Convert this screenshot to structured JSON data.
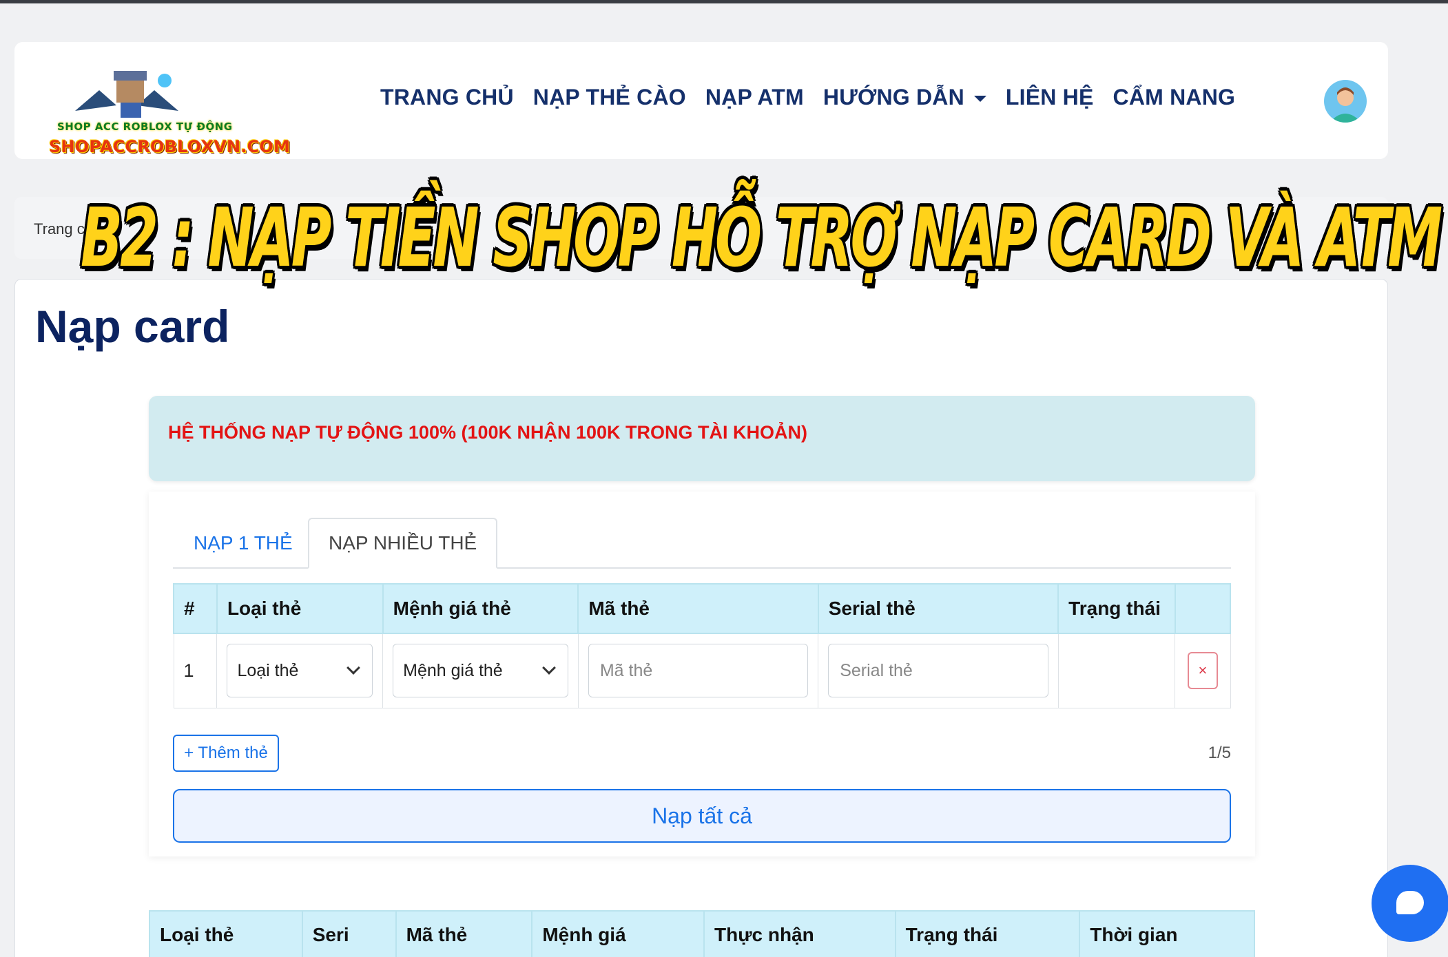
{
  "logo": {
    "line1": "SHOP ACC ROBLOX TỰ ĐỘNG",
    "line2": "SHOPACCROBLOXVN.COM"
  },
  "nav": {
    "items": [
      "TRANG CHỦ",
      "NẠP THẺ CÀO",
      "NẠP ATM",
      "HƯỚNG DẪN",
      "LIÊN HỆ",
      "CẨM NANG"
    ]
  },
  "breadcrumb": {
    "text": "Trang c"
  },
  "banner": {
    "text": "B2 : NẠP TIỀN SHOP HỖ TRỢ NẠP CARD VÀ ATM"
  },
  "page": {
    "title": "Nạp card"
  },
  "alert": {
    "text": "HỆ THỐNG NẠP TỰ ĐỘNG 100% (100K NHẬN 100K TRONG TÀI KHOẢN)"
  },
  "tabs": {
    "single": "NẠP 1 THẺ",
    "multi": "NẠP NHIỀU THẺ"
  },
  "form_table": {
    "headers": [
      "#",
      "Loại thẻ",
      "Mệnh giá thẻ",
      "Mã thẻ",
      "Serial thẻ",
      "Trạng thái",
      ""
    ],
    "row": {
      "index": "1",
      "card_type": "Loại thẻ",
      "denomination": "Mệnh giá thẻ",
      "code_placeholder": "Mã thẻ",
      "serial_placeholder": "Serial thẻ",
      "status": "",
      "delete": "×"
    }
  },
  "actions": {
    "add_card": "+ Thêm thẻ",
    "count": "1/5",
    "submit_all": "Nạp tất cả"
  },
  "history_table": {
    "headers": [
      "Loại thẻ",
      "Seri",
      "Mã thẻ",
      "Mệnh giá",
      "Thực nhận",
      "Trạng thái",
      "Thời gian"
    ]
  },
  "colors": {
    "nav": "#15306b",
    "accent": "#1a73e8",
    "alert_text": "#e31414",
    "table_header": "#cff0fa",
    "banner": "#ffd21a"
  }
}
